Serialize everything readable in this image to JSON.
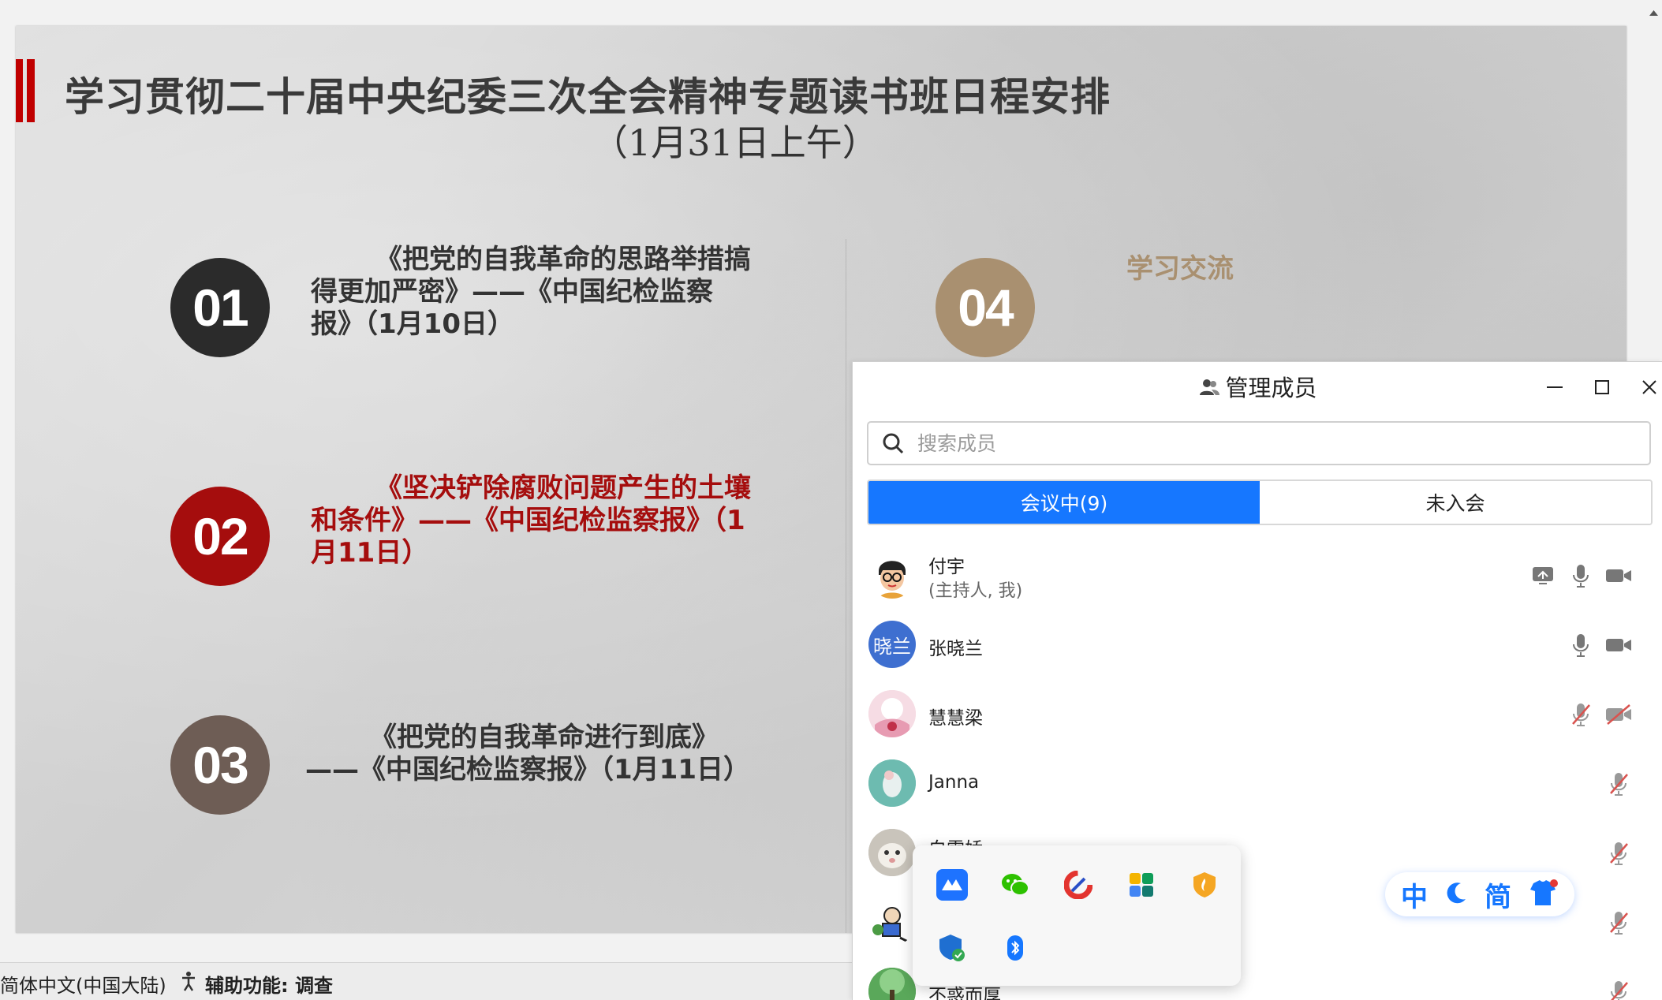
{
  "slide": {
    "title": "学习贯彻二十届中央纪委三次全会精神专题读书班日程安排",
    "subtitle": "（1月31日上午）",
    "items": [
      {
        "number": "01",
        "text": "《把党的自我革命的思路举措搞得更加严密》——《中国纪检监察报》（1月10日）",
        "circle_color": "#2b2b2b",
        "text_color": "#333333"
      },
      {
        "number": "02",
        "text": "《坚决铲除腐败问题产生的土壤和条件》——《中国纪检监察报》（1月11日）",
        "circle_color": "#a50d0d",
        "text_color": "#a50d0d"
      },
      {
        "number": "03",
        "text": "《把党的自我革命进行到底》——《中国纪检监察报》（1月11日）",
        "circle_color": "#6e5d55",
        "text_color": "#333333"
      },
      {
        "number": "04",
        "text": "学习交流",
        "circle_color": "#a99070",
        "text_color": "#a99070"
      }
    ]
  },
  "statusbar": {
    "language": "简体中文(中国大陆)",
    "accessibility": "辅助功能: 调查"
  },
  "panel": {
    "title": "管理成员",
    "search_placeholder": "搜索成员",
    "tabs": [
      {
        "label": "会议中(9)",
        "active": true
      },
      {
        "label": "未入会",
        "active": false
      }
    ],
    "members": [
      {
        "name": "付宇",
        "sub": "(主持人, 我)",
        "avatar": "cartoon",
        "icons": [
          "share-screen-icon",
          "mic-icon",
          "camera-icon"
        ]
      },
      {
        "name": "张晓兰",
        "avatar_text": "晓兰",
        "avatar_color": "#3e6fd0",
        "icons": [
          "mic-icon",
          "camera-icon"
        ]
      },
      {
        "name": "慧慧梁",
        "avatar": "pink",
        "icons": [
          "mic-muted-icon",
          "camera-off-icon"
        ]
      },
      {
        "name": "Janna",
        "avatar": "teal",
        "icons": [
          "mic-muted-icon"
        ]
      },
      {
        "name": "白雪娇",
        "avatar": "cat",
        "icons": [
          "mic-muted-icon"
        ]
      },
      {
        "name": "",
        "avatar": "popeye",
        "icons": [
          "mic-muted-icon"
        ]
      },
      {
        "name": "不惑而厚",
        "avatar": "green",
        "icons": [
          "mic-muted-icon"
        ]
      }
    ]
  },
  "tray": {
    "icons": [
      "feishu-icon",
      "wechat-icon",
      "ccleaner-icon",
      "colorful-app-icon",
      "shield-flame-icon",
      "security-shield-icon",
      "bluetooth-icon"
    ]
  },
  "ime": {
    "mode": "中",
    "script": "简"
  },
  "colors": {
    "accent": "#1677ff",
    "slide_red": "#c00000",
    "muted_red": "#d9534f"
  }
}
